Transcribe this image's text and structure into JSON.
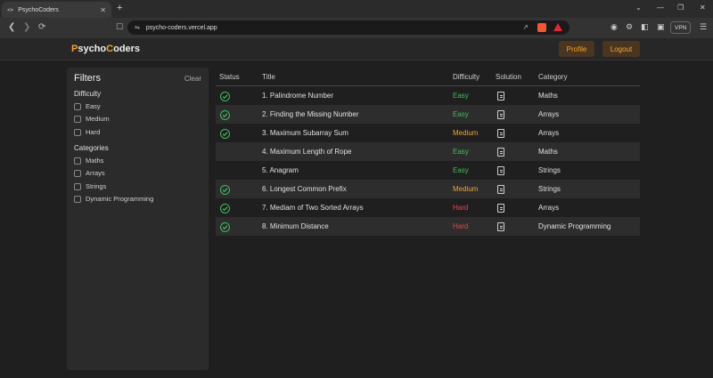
{
  "browser": {
    "tab_favicon": "<>",
    "tab_title": "PsychoCoders",
    "tab_close": "✕",
    "new_tab": "+",
    "url": "psycho-coders.vercel.app",
    "vpn_label": "VPN",
    "icons": [
      "back-icon",
      "forward-icon",
      "reload-icon",
      "bookmark-icon",
      "share-icon",
      "brave-shield-icon",
      "brave-rewards-icon",
      "camera-icon",
      "extensions-icon",
      "sidebar-icon",
      "wallet-icon",
      "menu-icon"
    ],
    "window_controls": [
      "⌄",
      "—",
      "❐",
      "✕"
    ]
  },
  "header": {
    "logo_first": "P",
    "logo_mid1": "sycho",
    "logo_c": "C",
    "logo_rest": "oders",
    "profile_label": "Profile",
    "logout_label": "Logout",
    "accent_color": "#f5a623"
  },
  "filters": {
    "title": "Filters",
    "clear_label": "Clear",
    "difficulty_label": "Difficulty",
    "difficulty_options": [
      "Easy",
      "Medium",
      "Hard"
    ],
    "categories_label": "Categories",
    "category_options": [
      "Maths",
      "Arrays",
      "Strings",
      "Dynamic Programming"
    ]
  },
  "table": {
    "headers": [
      "Status",
      "Title",
      "Difficulty",
      "Solution",
      "Category"
    ],
    "rows": [
      {
        "solved": true,
        "title": "1. Palindrome Number",
        "difficulty": "Easy",
        "category": "Maths"
      },
      {
        "solved": true,
        "title": "2. Finding the Missing Number",
        "difficulty": "Easy",
        "category": "Arrays"
      },
      {
        "solved": true,
        "title": "3. Maximum Subarray Sum",
        "difficulty": "Medium",
        "category": "Arrays"
      },
      {
        "solved": false,
        "title": "4. Maximum Length of Rope",
        "difficulty": "Easy",
        "category": "Maths"
      },
      {
        "solved": false,
        "title": "5. Anagram",
        "difficulty": "Easy",
        "category": "Strings"
      },
      {
        "solved": true,
        "title": "6. Longest Common Prefix",
        "difficulty": "Medium",
        "category": "Strings"
      },
      {
        "solved": true,
        "title": "7. Mediam of Two Sorted Arrays",
        "difficulty": "Hard",
        "category": "Arrays"
      },
      {
        "solved": true,
        "title": "8. Minimum Distance",
        "difficulty": "Hard",
        "category": "Dynamic Programming"
      }
    ],
    "difficulty_colors": {
      "Easy": "#3cc05a",
      "Medium": "#f5a623",
      "Hard": "#e5484d"
    }
  }
}
